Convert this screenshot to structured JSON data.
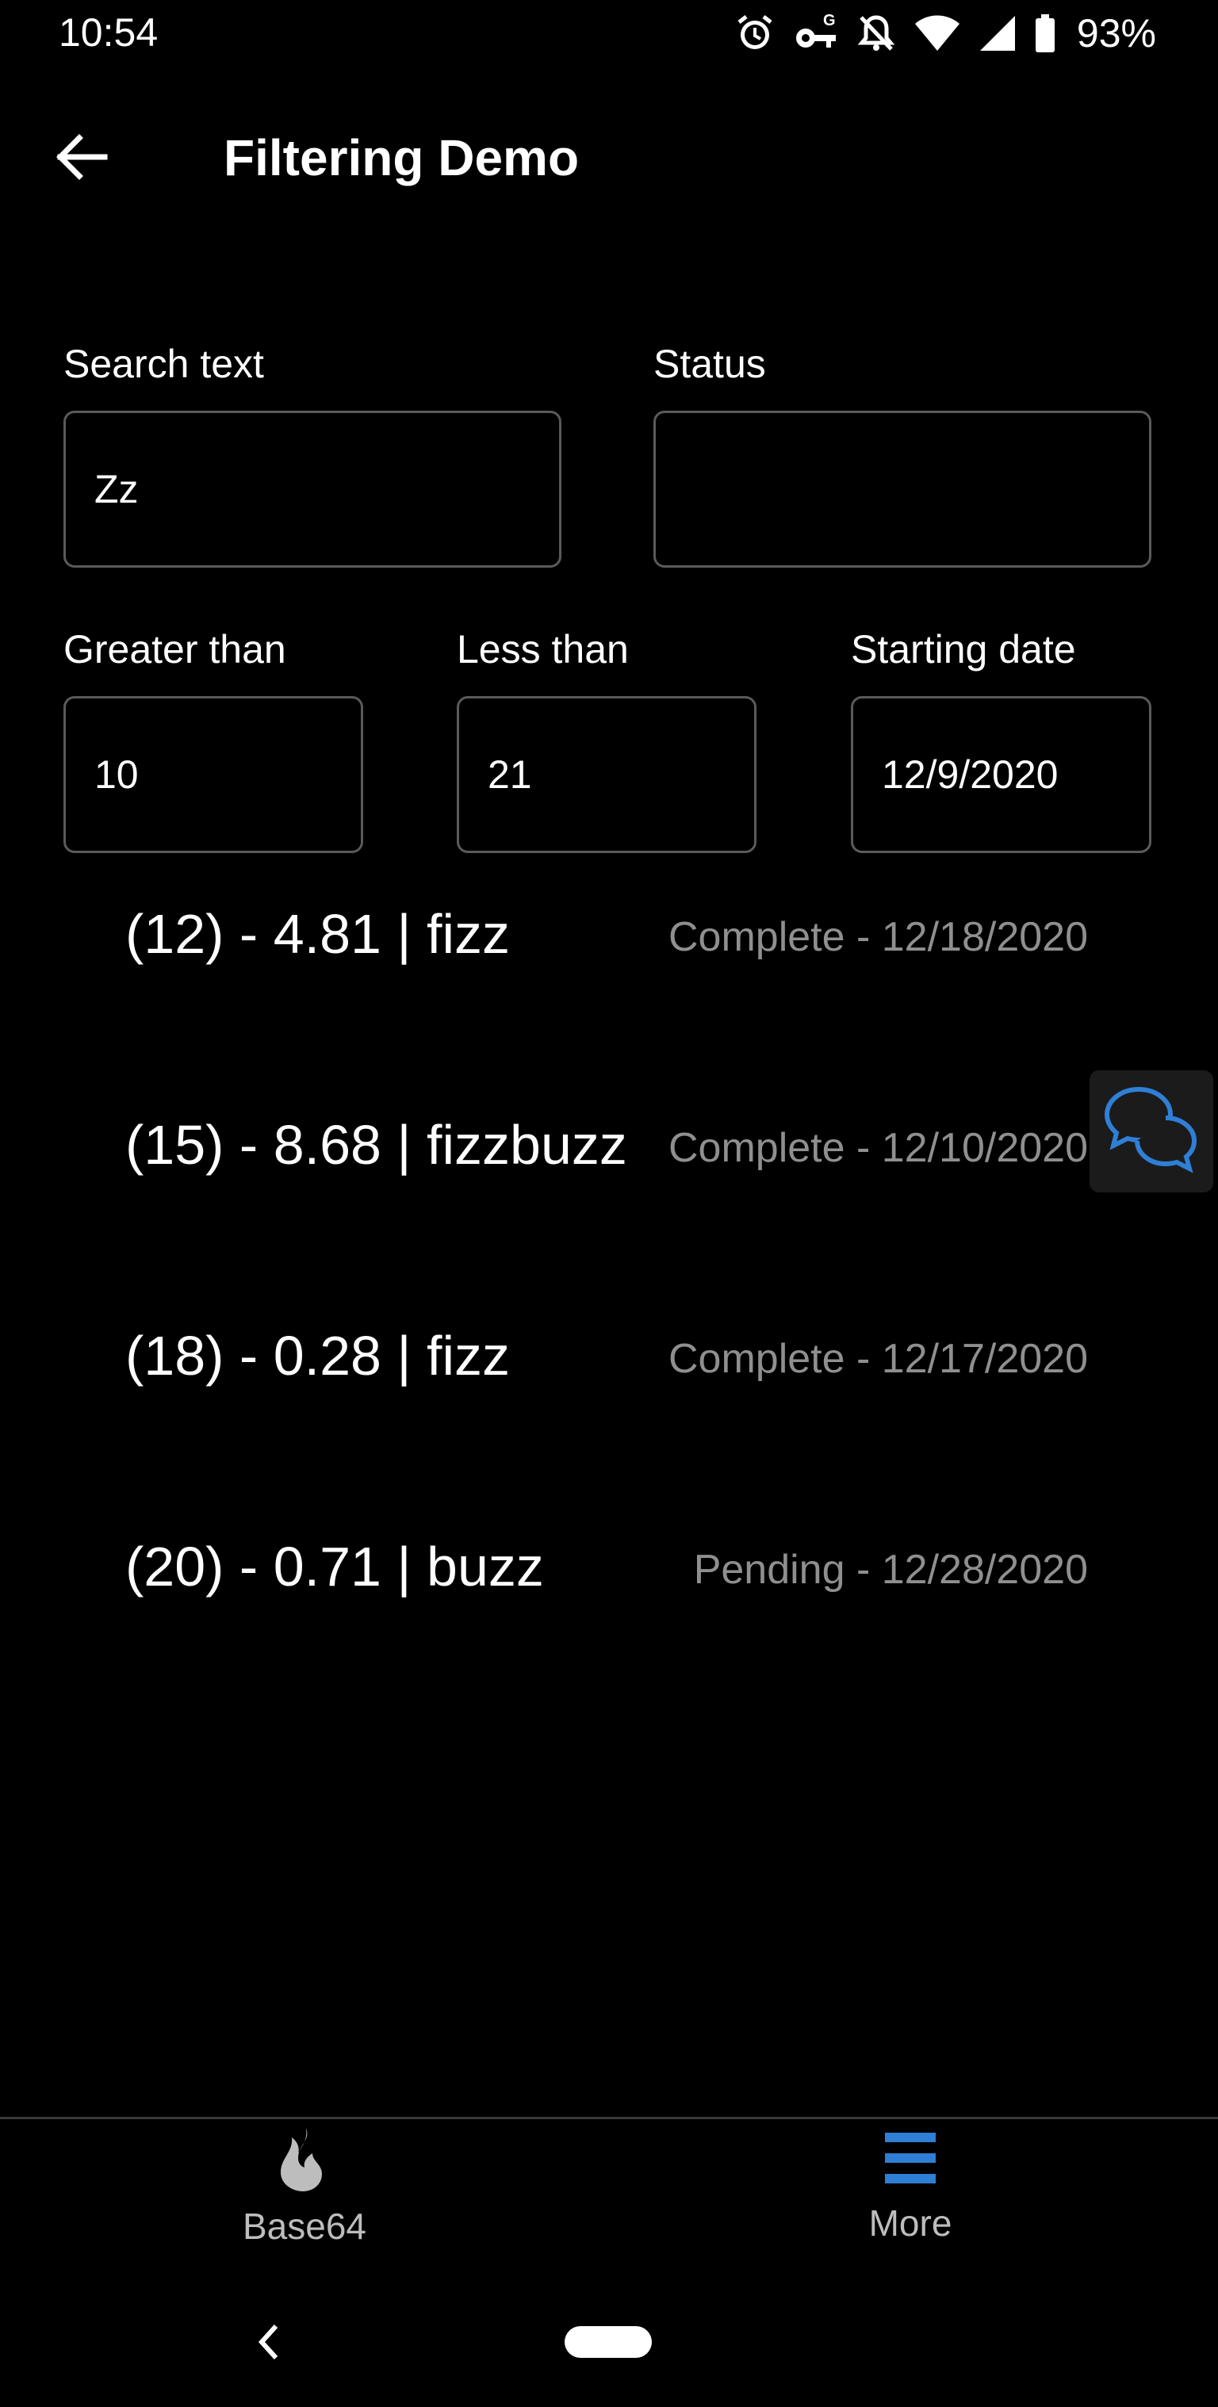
{
  "status_bar": {
    "time": "10:54",
    "battery": "93%",
    "icons": [
      "alarm-icon",
      "vpn-key-icon",
      "notifications-off-icon",
      "wifi-icon",
      "cell-signal-icon",
      "battery-icon"
    ]
  },
  "app_bar": {
    "title": "Filtering Demo",
    "back_icon": "arrow-left-icon"
  },
  "filters": {
    "search_text": {
      "label": "Search text",
      "value": "Zz"
    },
    "status": {
      "label": "Status",
      "value": ""
    },
    "greater_than": {
      "label": "Greater than",
      "value": "10"
    },
    "less_than": {
      "label": "Less than",
      "value": "21"
    },
    "starting_date": {
      "label": "Starting date",
      "value": "12/9/2020"
    }
  },
  "results": [
    {
      "main": "(12) - 4.81 | fizz",
      "meta": "Complete - 12/18/2020"
    },
    {
      "main": "(15) - 8.68 | fizzbuzz",
      "meta": "Complete - 12/10/2020"
    },
    {
      "main": "(18) - 0.28 | fizz",
      "meta": "Complete - 12/17/2020"
    },
    {
      "main": "(20) - 0.71 | buzz",
      "meta": "Pending - 12/28/2020"
    }
  ],
  "chat_fab": {
    "icon": "chat-bubbles-icon",
    "accent": "#2f7fd6"
  },
  "bottom_nav": {
    "items": [
      {
        "label": "Base64",
        "icon": "flame-icon"
      },
      {
        "label": "More",
        "icon": "menu-icon"
      }
    ],
    "accent": "#2f7fd6"
  },
  "system_nav": {
    "back_icon": "chevron-left-icon",
    "home": "home-pill"
  }
}
